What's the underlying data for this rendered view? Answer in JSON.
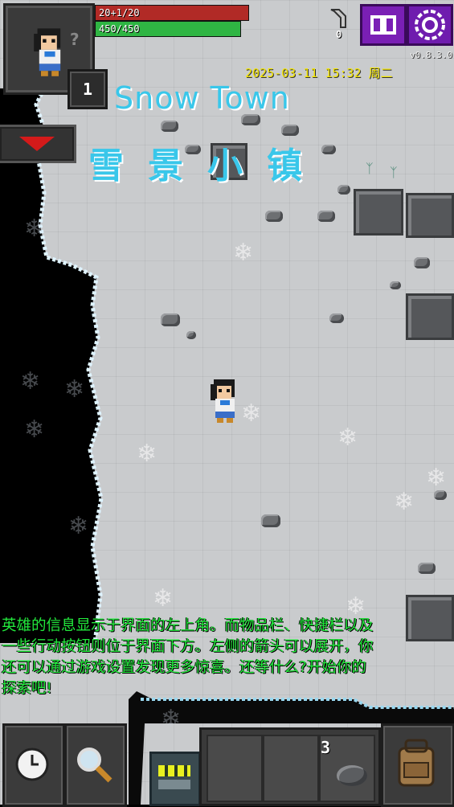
{
  "status": {
    "hp_text": "20+1/20",
    "hp_fraction": 1.0,
    "xp_text": "450/450",
    "xp_fraction": 1.0,
    "level": "1",
    "flag_count": "0"
  },
  "header": {
    "version": "v0.8.3.0",
    "datetime": "2025-03-11 15:32 周二"
  },
  "zone": {
    "title_en": "Snow Town",
    "title_zh": "雪景小镇"
  },
  "tip": {
    "text": "英雄的信息显示于界面的左上角。而物品栏、快捷栏以及一些行动按钮则位于界面下方。左侧的箭头可以展开，你还可以通过游戏设置发现更多惊喜。还等什么?开始你的探索吧!"
  },
  "toolbar": {
    "quickslot_qty": "3"
  },
  "icons": {
    "portrait": "hero-portrait-icon",
    "flag": "flag-icon",
    "journal": "journal-icon",
    "settings": "settings-gear-icon",
    "expand": "expand-arrow-icon",
    "wait": "clock-icon",
    "search": "magnifier-icon",
    "backpack": "backpack-icon",
    "stone": "stone-icon"
  },
  "colors": {
    "hp": "#b12a26",
    "xp": "#2fb543",
    "title": "#39c7ea",
    "tip": "#22e83c",
    "datetime": "#f5e600",
    "menu_buttons": "#7a1fb5"
  }
}
